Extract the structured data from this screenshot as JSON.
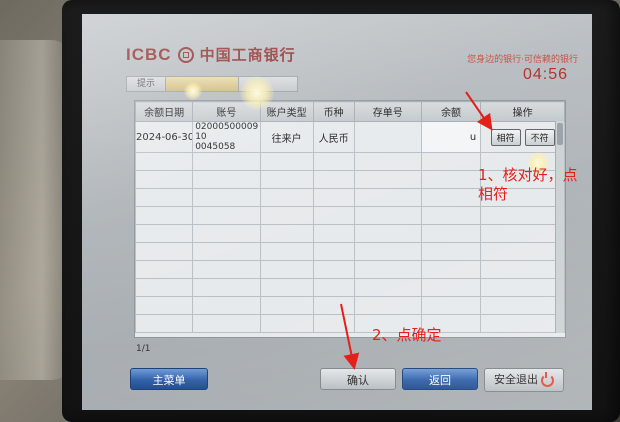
{
  "header": {
    "logo_text": "ICBC",
    "logo_icon": "icbc-seal-icon",
    "bank_name": "中国工商银行",
    "slogan": "您身边的银行·可信赖的银行",
    "clock": "04:56"
  },
  "breadcrumbs": [
    {
      "label": "提示",
      "active": false
    },
    {
      "label": "",
      "active": true
    },
    {
      "label": "",
      "active": false
    }
  ],
  "table": {
    "columns": [
      "余额日期",
      "账号",
      "账户类型",
      "币种",
      "存单号",
      "余额",
      "操作"
    ],
    "rows": [
      {
        "date": "2024-06-30",
        "account_line1": "0200050000910",
        "account_line2": "0045058",
        "account_type": "往来户",
        "currency": "人民币",
        "deposit_no": "",
        "balance": "u",
        "match_label": "相符",
        "mismatch_label": "不符"
      }
    ]
  },
  "pager": "1/1",
  "footer": {
    "main_menu": "主菜单",
    "confirm": "确认",
    "back": "返回",
    "exit": "安全退出",
    "exit_icon": "power-icon"
  },
  "annotations": {
    "step1_line1": "1、核对好，点",
    "step1_line2": "相符",
    "step2": "2、点确定",
    "color": "#e4201b"
  }
}
